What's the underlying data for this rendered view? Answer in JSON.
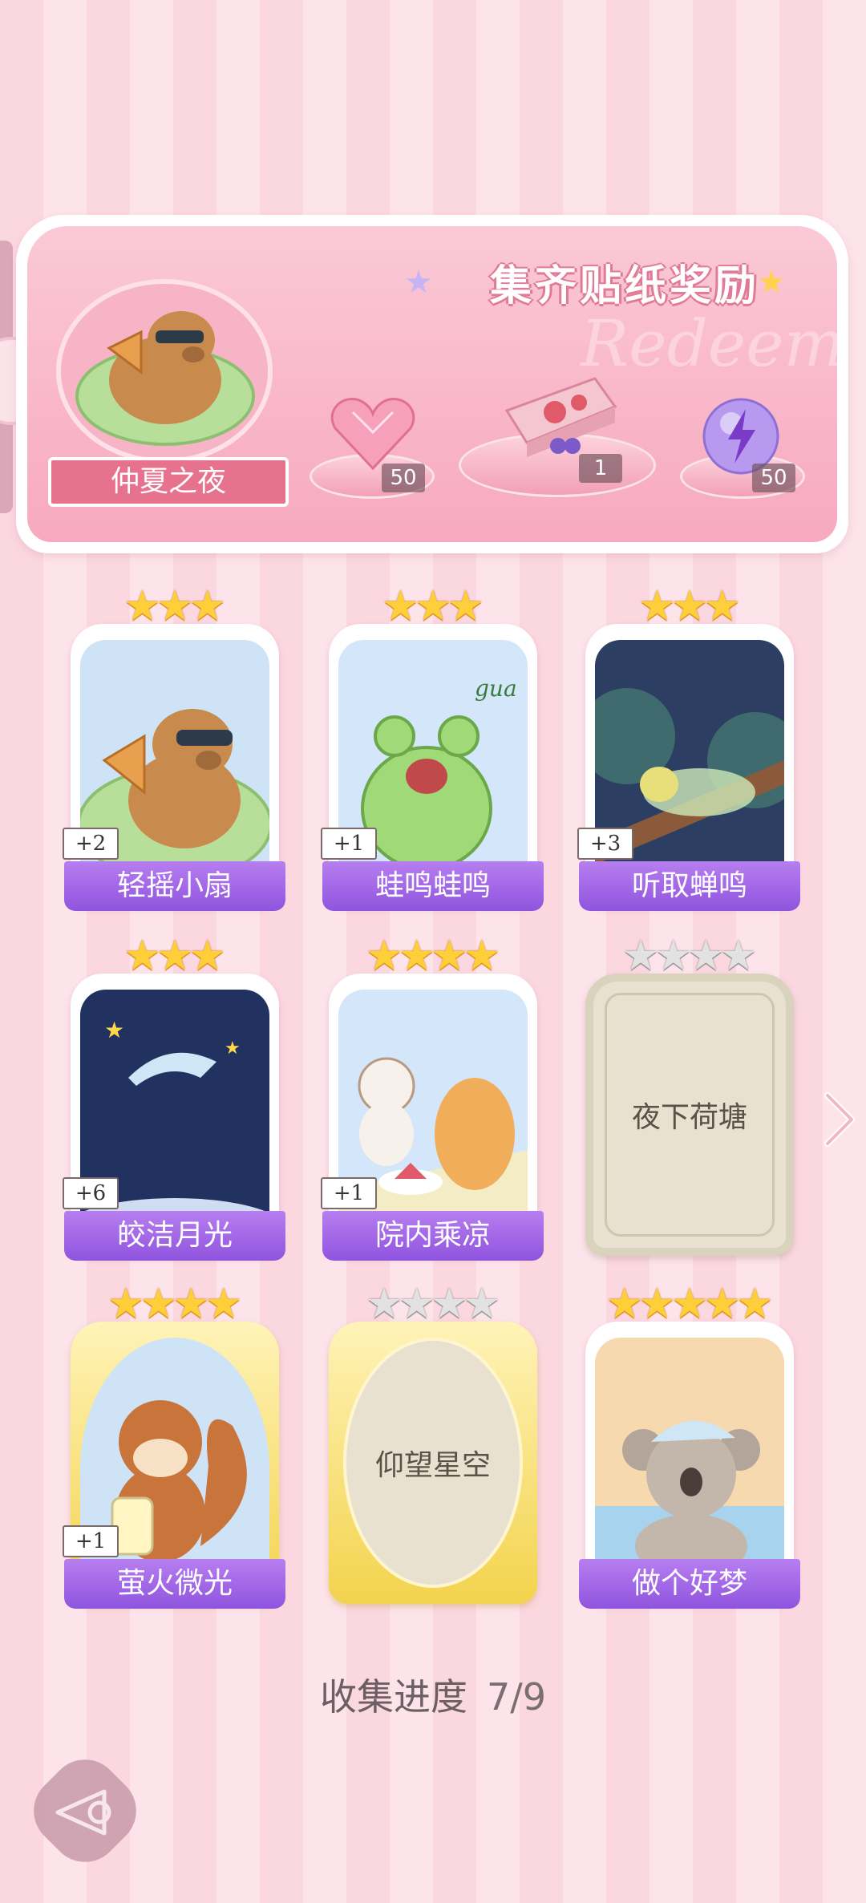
{
  "banner": {
    "title": "集齐贴纸奖励",
    "watermark": "Redeem",
    "collection_name": "仲夏之夜",
    "rewards": [
      {
        "icon": "pink-heart-gem-icon",
        "count": "50"
      },
      {
        "icon": "gift-box-icon",
        "count": "1"
      },
      {
        "icon": "lightning-orb-icon",
        "count": "50"
      }
    ]
  },
  "stickers": [
    {
      "name": "轻摇小扇",
      "stars": 3,
      "max_stars": 3,
      "collected": true,
      "bonus": "+2",
      "art": "capybara-fan"
    },
    {
      "name": "蛙鸣蛙鸣",
      "stars": 3,
      "max_stars": 3,
      "collected": true,
      "bonus": "+1",
      "art": "frog",
      "art_text": "gua"
    },
    {
      "name": "听取蝉鸣",
      "stars": 3,
      "max_stars": 3,
      "collected": true,
      "bonus": "+3",
      "art": "cicada"
    },
    {
      "name": "皎洁月光",
      "stars": 3,
      "max_stars": 3,
      "collected": true,
      "bonus": "+6",
      "art": "moon"
    },
    {
      "name": "院内乘凉",
      "stars": 4,
      "max_stars": 4,
      "collected": true,
      "bonus": "+1",
      "art": "cats-picnic"
    },
    {
      "name": "夜下荷塘",
      "stars": 0,
      "max_stars": 4,
      "collected": false,
      "bonus": "",
      "art": "locked"
    },
    {
      "name": "萤火微光",
      "stars": 4,
      "max_stars": 4,
      "collected": true,
      "bonus": "+1",
      "art": "squirrel"
    },
    {
      "name": "仰望星空",
      "stars": 0,
      "max_stars": 4,
      "collected": false,
      "bonus": "",
      "art": "locked-gold"
    },
    {
      "name": "做个好梦",
      "stars": 5,
      "max_stars": 5,
      "collected": true,
      "bonus": "",
      "art": "koala"
    }
  ],
  "progress": {
    "label": "收集进度",
    "value": "7/9"
  },
  "colors": {
    "accent_purple": "#9b5fe4",
    "star_gold": "#ffcf3a",
    "banner_pink": "#f7a9bf"
  }
}
